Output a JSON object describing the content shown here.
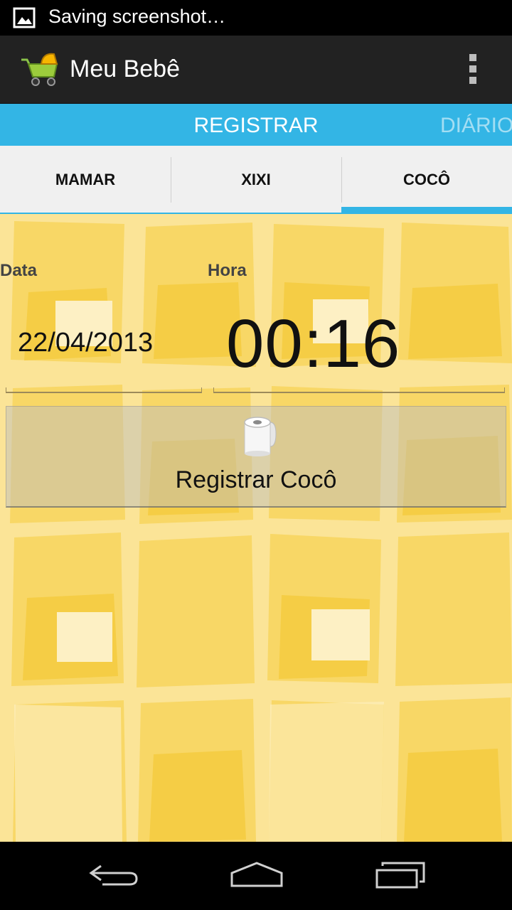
{
  "status_bar": {
    "notification_text": "Saving screenshot…",
    "icon": "image-icon"
  },
  "action_bar": {
    "app_title": "Meu Bebê",
    "app_icon": "baby-stroller-icon",
    "overflow_icon": "overflow-menu-icon"
  },
  "pager": {
    "current": "REGISTRAR",
    "next": "DIÁRIO"
  },
  "tabs": [
    {
      "label": "MAMAR",
      "active": false
    },
    {
      "label": "XIXI",
      "active": false
    },
    {
      "label": "COCÔ",
      "active": true
    }
  ],
  "form": {
    "date_label": "Data",
    "time_label": "Hora",
    "date_value": "22/04/2013",
    "time_value": "00:16"
  },
  "register_button": {
    "label": "Registrar Cocô",
    "icon": "toilet-paper-icon"
  },
  "nav_bar": {
    "back_icon": "back-icon",
    "home_icon": "home-icon",
    "recents_icon": "recent-apps-icon"
  },
  "colors": {
    "accent": "#33b5e5",
    "action_bar": "#222222",
    "content_bg": "#fbe79a"
  }
}
